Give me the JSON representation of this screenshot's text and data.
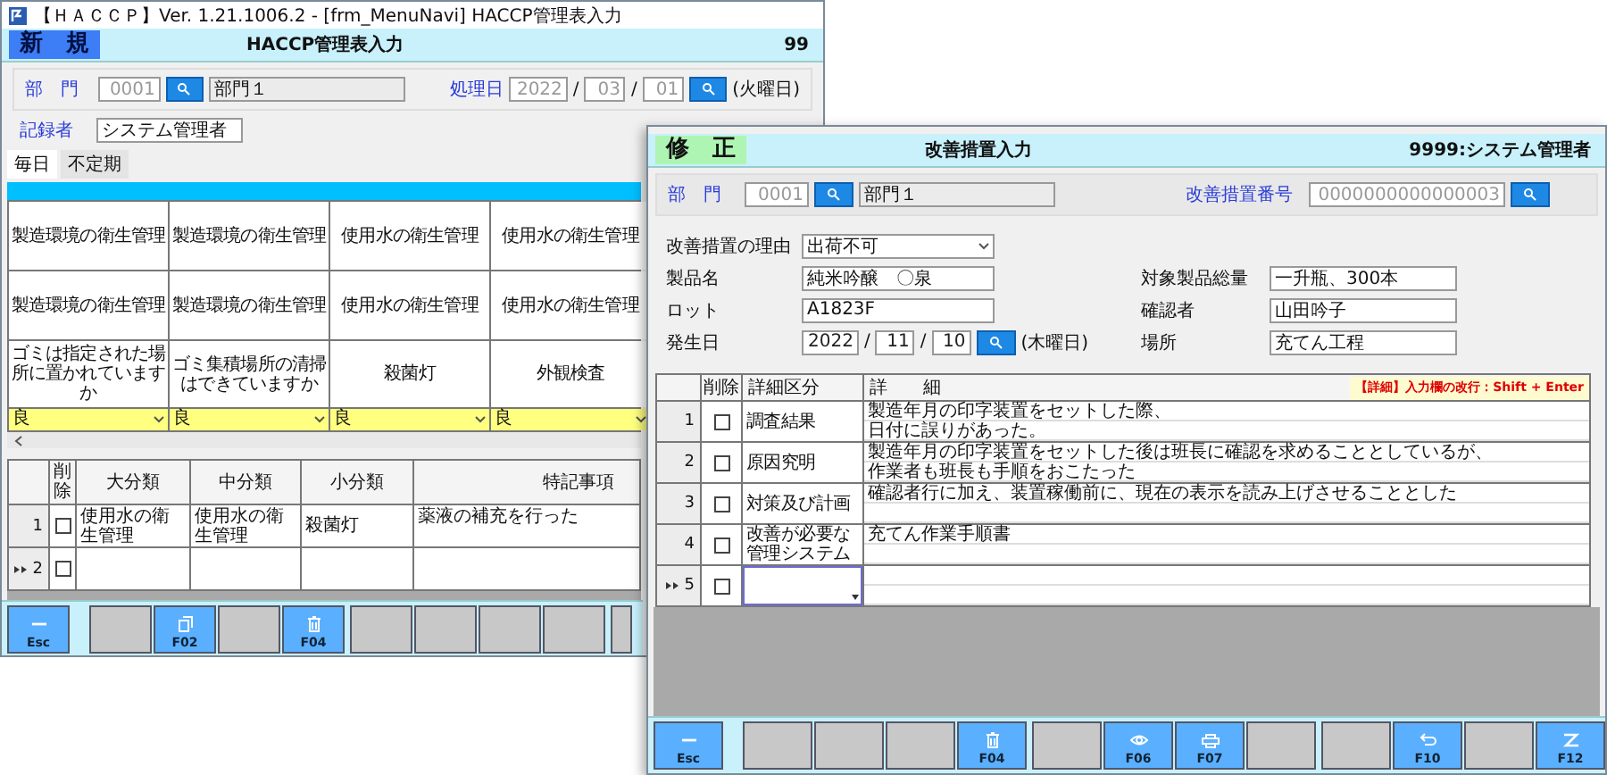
{
  "back_window": {
    "title": "【ＨＡＣＣＰ】Ver. 1.21.1006.2 - [frm_MenuNavi] HACCP管理表入力",
    "mode": {
      "label": "新　規",
      "kind": "new"
    },
    "heading": "HACCP管理表入力",
    "user": "99",
    "department": {
      "label": "部　門",
      "code": "0001",
      "name": "部門１"
    },
    "date": {
      "label": "処理日",
      "year": "2022",
      "month": "03",
      "day": "01",
      "separator": "/",
      "weekday": "(火曜日)"
    },
    "recorder": {
      "label": "記録者",
      "value": "システム管理者"
    },
    "tabs": [
      {
        "label": "毎日",
        "selected": true
      },
      {
        "label": "不定期",
        "selected": false
      }
    ],
    "check_columns": [
      {
        "category": "製造環境の衛生管理",
        "subcategory": "製造環境の衛生管理",
        "item": "ゴミは指定された場所に置かれていますか",
        "value": "良"
      },
      {
        "category": "製造環境の衛生管理",
        "subcategory": "製造環境の衛生管理",
        "item": "ゴミ集積場所の清掃はできていますか",
        "value": "良"
      },
      {
        "category": "使用水の衛生管理",
        "subcategory": "使用水の衛生管理",
        "item": "殺菌灯",
        "value": "良"
      },
      {
        "category": "使用水の衛生管理",
        "subcategory": "使用水の衛生管理",
        "item": "外観検査",
        "value": "良"
      }
    ],
    "table": {
      "delete_column": "削除",
      "columns": [
        "大分類",
        "中分類",
        "小分類",
        "特記事項"
      ],
      "rows": [
        {
          "number": "1",
          "deleted": false,
          "current": false,
          "cells": [
            "使用水の衛生管理",
            "使用水の衛生管理",
            "殺菌灯",
            "薬液の補充を行った"
          ]
        },
        {
          "number": "2",
          "deleted": false,
          "current": true,
          "cells": []
        }
      ]
    },
    "function_key_groups": [
      [
        {
          "kind": "close",
          "label": "Esc",
          "enabled": true
        }
      ],
      [
        {
          "enabled": false
        },
        {
          "kind": "copy",
          "label": "F02",
          "enabled": true
        },
        {
          "enabled": false
        },
        {
          "kind": "delete",
          "label": "F04",
          "enabled": true
        }
      ],
      [
        {
          "enabled": false
        },
        {
          "enabled": false
        },
        {
          "enabled": false
        },
        {
          "enabled": false
        }
      ],
      [
        {
          "enabled": false
        }
      ]
    ]
  },
  "front_window": {
    "mode": {
      "label": "修　正",
      "kind": "edit"
    },
    "heading": "改善措置入力",
    "user": "9999:システム管理者",
    "department": {
      "label": "部　門",
      "code": "0001",
      "name": "部門１"
    },
    "measure_number": {
      "label": "改善措置番号",
      "value": "0000000000000003"
    },
    "reason": {
      "label": "改善措置の理由",
      "value": "出荷不可"
    },
    "product": {
      "label": "製品名",
      "value": "純米吟醸　〇泉"
    },
    "quantity": {
      "label": "対象製品総量",
      "value": "一升瓶、300本"
    },
    "lot": {
      "label": "ロット",
      "value": "A1823F"
    },
    "confirmer": {
      "label": "確認者",
      "value": "山田吟子"
    },
    "occurred": {
      "label": "発生日",
      "year": "2022",
      "month": "11",
      "day": "10",
      "separator": "/",
      "weekday": "(木曜日)"
    },
    "place": {
      "label": "場所",
      "value": "充てん工程"
    },
    "table": {
      "delete_column": "削除",
      "columns": [
        "詳細区分",
        "詳　　細"
      ],
      "hint": "【詳細】入力欄の改行：Shift + Enter",
      "rows": [
        {
          "number": "1",
          "deleted": false,
          "current": false,
          "category": "調査結果",
          "lines": [
            "製造年月の印字装置をセットした際、",
            "日付に誤りがあった。"
          ]
        },
        {
          "number": "2",
          "deleted": false,
          "current": false,
          "category": "原因究明",
          "lines": [
            "製造年月の印字装置をセットした後は班長に確認を求めることとしているが、",
            "作業者も班長も手順をおこたった"
          ]
        },
        {
          "number": "3",
          "deleted": false,
          "current": false,
          "category": "対策及び計画",
          "lines": [
            "確認者行に加え、装置稼働前に、現在の表示を読み上げさせることとした"
          ]
        },
        {
          "number": "4",
          "deleted": false,
          "current": false,
          "category": "改善が必要な管理システム",
          "lines": [
            "充てん作業手順書"
          ]
        },
        {
          "number": "5",
          "deleted": false,
          "current": true
        }
      ]
    },
    "function_key_groups": [
      [
        {
          "kind": "close",
          "label": "Esc",
          "enabled": true
        }
      ],
      [
        {
          "enabled": false
        },
        {
          "enabled": false
        },
        {
          "enabled": false
        },
        {
          "kind": "delete",
          "label": "F04",
          "enabled": true
        }
      ],
      [
        {
          "enabled": false
        },
        {
          "kind": "preview",
          "label": "F06",
          "enabled": true
        },
        {
          "kind": "print",
          "label": "F07",
          "enabled": true
        },
        {
          "enabled": false
        }
      ],
      [
        {
          "enabled": false
        },
        {
          "kind": "undo",
          "label": "F10",
          "enabled": true
        },
        {
          "enabled": false
        },
        {
          "kind": "finish",
          "label": "F12",
          "enabled": true
        }
      ]
    ]
  }
}
